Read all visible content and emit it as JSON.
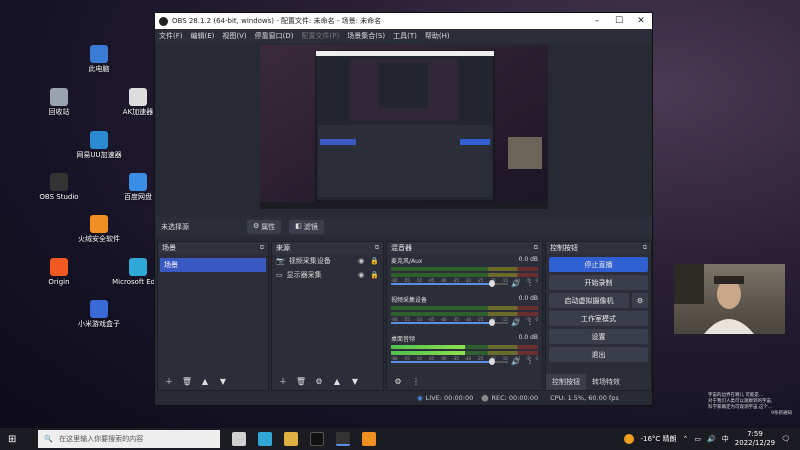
{
  "desktop_icons": [
    {
      "label": "此电脑",
      "color": "#3a7bd5"
    },
    {
      "label": "回收站",
      "color": "#9aa4b0"
    },
    {
      "label": "AK加速器",
      "color": "#dddddd"
    },
    {
      "label": "网易UU加速器",
      "color": "#2a8ad0"
    },
    {
      "label": "OBS Studio",
      "color": "#333333"
    },
    {
      "label": "百度网盘",
      "color": "#3a8ee6"
    },
    {
      "label": "火绒安全软件",
      "color": "#f09020"
    },
    {
      "label": "Origin",
      "color": "#f05a22"
    },
    {
      "label": "Microsoft Edge",
      "color": "#2fa8d8"
    },
    {
      "label": "小米游戏盒子",
      "color": "#3a6ad5"
    }
  ],
  "obs": {
    "title": "OBS 28.1.2 (64-bit, windows) - 配置文件: 未命名 - 场景: 未命名",
    "menu": [
      "文件(F)",
      "编辑(E)",
      "视图(V)",
      "停靠窗口(D)",
      "配置文件(P)",
      "场景集合(S)",
      "工具(T)",
      "帮助(H)"
    ],
    "no_source": "未选择源",
    "properties_btn": "属性",
    "filters_btn": "滤镜",
    "scenes": {
      "header": "场景",
      "items": [
        "场景"
      ]
    },
    "sources": {
      "header": "来源",
      "items": [
        "视频采集设备",
        "显示器采集"
      ]
    },
    "mixer": {
      "header": "混音器",
      "channels": [
        {
          "name": "麦克风/Aux",
          "db": "0.0 dB",
          "level": 0.0,
          "volume": 0.86
        },
        {
          "name": "视频采集设备",
          "db": "0.0 dB",
          "level": 0.0,
          "volume": 0.86
        },
        {
          "name": "桌面音频",
          "db": "0.0 dB",
          "level": 0.5,
          "volume": 0.86
        }
      ],
      "ticks": [
        "-60",
        "-55",
        "-50",
        "-45",
        "-40",
        "-35",
        "-30",
        "-25",
        "-20",
        "-15",
        "-10",
        "-5",
        "0"
      ]
    },
    "controls": {
      "header": "控制按钮",
      "buttons": [
        "停止直播",
        "开始录制",
        "启动虚拟摄像机",
        "工作室模式",
        "设置",
        "退出"
      ],
      "tabs": [
        "控制按钮",
        "转场特效"
      ]
    },
    "status": {
      "live": "LIVE: 00:00:00",
      "rec": "REC: 00:00:00",
      "cpu": "CPU: 1.5%, 60.00 fps"
    }
  },
  "taskbar": {
    "search_placeholder": "在这里输入你要搜索的内容",
    "weather": "-16°C 晴朗",
    "ime": "中",
    "time": "7:59",
    "date": "2022/12/29"
  },
  "overlay_notes": [
    "宇宙的边界在哪儿 可能是...",
    "对于我们人类可以观察到的宇宙,",
    "科学家确定为可观测宇宙,这个...",
    "9条新通知"
  ]
}
